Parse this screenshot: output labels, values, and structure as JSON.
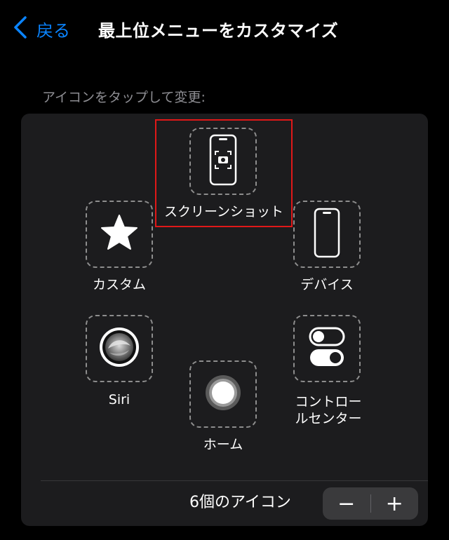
{
  "nav": {
    "back_label": "戻る",
    "title": "最上位メニューをカスタマイズ"
  },
  "hint": "アイコンをタップして変更:",
  "icons": [
    {
      "id": "screenshot",
      "label": "スクリーンショット",
      "icon": "screenshot-icon",
      "highlighted": true
    },
    {
      "id": "custom",
      "label": "カスタム",
      "icon": "star-icon"
    },
    {
      "id": "device",
      "label": "デバイス",
      "icon": "device-icon"
    },
    {
      "id": "siri",
      "label": "Siri",
      "icon": "siri-icon"
    },
    {
      "id": "control_center",
      "label": "コントロールセンター",
      "label_lines": [
        "コントロー",
        "ルセンター"
      ],
      "icon": "control-center-icon"
    },
    {
      "id": "home",
      "label": "ホーム",
      "icon": "home-button-icon"
    }
  ],
  "footer": {
    "count_label": "6個のアイコン",
    "minus": "−",
    "plus": "+"
  },
  "colors": {
    "accent": "#0a84ff",
    "panel": "#1c1c1e",
    "highlight": "#e01818"
  }
}
